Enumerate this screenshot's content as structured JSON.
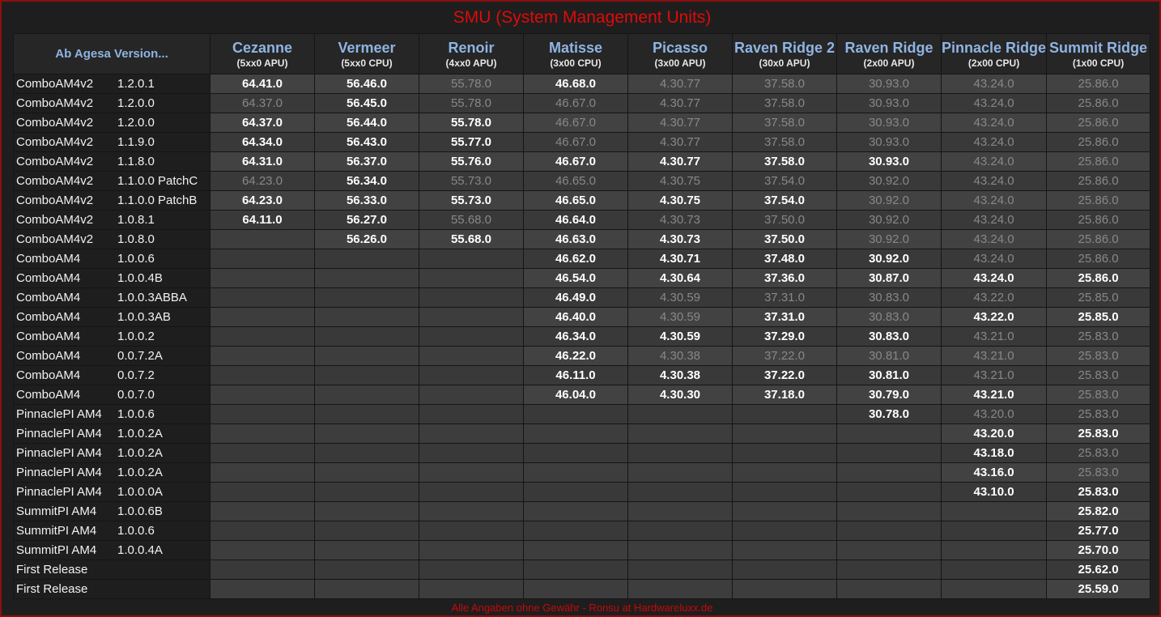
{
  "title": "SMU (System Management Units)",
  "footer": "Alle Angaben ohne Gewähr - Ronsu at Hardwareluxx.de",
  "corner_label": "Ab Agesa Version...",
  "columns": [
    {
      "name": "Cezanne",
      "sub": "(5xx0 APU)"
    },
    {
      "name": "Vermeer",
      "sub": "(5xx0 CPU)"
    },
    {
      "name": "Renoir",
      "sub": "(4xx0 APU)"
    },
    {
      "name": "Matisse",
      "sub": "(3x00 CPU)"
    },
    {
      "name": "Picasso",
      "sub": "(3x00 APU)"
    },
    {
      "name": "Raven Ridge 2",
      "sub": "(30x0 APU)"
    },
    {
      "name": "Raven Ridge",
      "sub": "(2x00 APU)"
    },
    {
      "name": "Pinnacle Ridge",
      "sub": "(2x00 CPU)"
    },
    {
      "name": "Summit Ridge",
      "sub": "(1x00 CPU)"
    }
  ],
  "colors": {
    "title_red": "#e00a0a",
    "header_blue": "#8fb4e3",
    "value_bright": "#ffffff",
    "value_dim": "#888888"
  },
  "rows": [
    {
      "board": "ComboAM4v2",
      "ver": "1.2.0.1",
      "cells": [
        [
          "64.41.0",
          "b"
        ],
        [
          "56.46.0",
          "b"
        ],
        [
          "55.78.0",
          "d"
        ],
        [
          "46.68.0",
          "b"
        ],
        [
          "4.30.77",
          "d"
        ],
        [
          "37.58.0",
          "d"
        ],
        [
          "30.93.0",
          "d"
        ],
        [
          "43.24.0",
          "d"
        ],
        [
          "25.86.0",
          "d"
        ]
      ]
    },
    {
      "board": "ComboAM4v2",
      "ver": "1.2.0.0",
      "cells": [
        [
          "64.37.0",
          "d"
        ],
        [
          "56.45.0",
          "b"
        ],
        [
          "55.78.0",
          "d"
        ],
        [
          "46.67.0",
          "d"
        ],
        [
          "4.30.77",
          "d"
        ],
        [
          "37.58.0",
          "d"
        ],
        [
          "30.93.0",
          "d"
        ],
        [
          "43.24.0",
          "d"
        ],
        [
          "25.86.0",
          "d"
        ]
      ]
    },
    {
      "board": "ComboAM4v2",
      "ver": "1.2.0.0",
      "cells": [
        [
          "64.37.0",
          "b"
        ],
        [
          "56.44.0",
          "b"
        ],
        [
          "55.78.0",
          "b"
        ],
        [
          "46.67.0",
          "d"
        ],
        [
          "4.30.77",
          "d"
        ],
        [
          "37.58.0",
          "d"
        ],
        [
          "30.93.0",
          "d"
        ],
        [
          "43.24.0",
          "d"
        ],
        [
          "25.86.0",
          "d"
        ]
      ]
    },
    {
      "board": "ComboAM4v2",
      "ver": "1.1.9.0",
      "cells": [
        [
          "64.34.0",
          "b"
        ],
        [
          "56.43.0",
          "b"
        ],
        [
          "55.77.0",
          "b"
        ],
        [
          "46.67.0",
          "d"
        ],
        [
          "4.30.77",
          "d"
        ],
        [
          "37.58.0",
          "d"
        ],
        [
          "30.93.0",
          "d"
        ],
        [
          "43.24.0",
          "d"
        ],
        [
          "25.86.0",
          "d"
        ]
      ]
    },
    {
      "board": "ComboAM4v2",
      "ver": "1.1.8.0",
      "cells": [
        [
          "64.31.0",
          "b"
        ],
        [
          "56.37.0",
          "b"
        ],
        [
          "55.76.0",
          "b"
        ],
        [
          "46.67.0",
          "b"
        ],
        [
          "4.30.77",
          "b"
        ],
        [
          "37.58.0",
          "b"
        ],
        [
          "30.93.0",
          "b"
        ],
        [
          "43.24.0",
          "d"
        ],
        [
          "25.86.0",
          "d"
        ]
      ]
    },
    {
      "board": "ComboAM4v2",
      "ver": "1.1.0.0 PatchC",
      "cells": [
        [
          "64.23.0",
          "d"
        ],
        [
          "56.34.0",
          "b"
        ],
        [
          "55.73.0",
          "d"
        ],
        [
          "46.65.0",
          "d"
        ],
        [
          "4.30.75",
          "d"
        ],
        [
          "37.54.0",
          "d"
        ],
        [
          "30.92.0",
          "d"
        ],
        [
          "43.24.0",
          "d"
        ],
        [
          "25.86.0",
          "d"
        ]
      ]
    },
    {
      "board": "ComboAM4v2",
      "ver": "1.1.0.0 PatchB",
      "cells": [
        [
          "64.23.0",
          "b"
        ],
        [
          "56.33.0",
          "b"
        ],
        [
          "55.73.0",
          "b"
        ],
        [
          "46.65.0",
          "b"
        ],
        [
          "4.30.75",
          "b"
        ],
        [
          "37.54.0",
          "b"
        ],
        [
          "30.92.0",
          "d"
        ],
        [
          "43.24.0",
          "d"
        ],
        [
          "25.86.0",
          "d"
        ]
      ]
    },
    {
      "board": "ComboAM4v2",
      "ver": "1.0.8.1",
      "cells": [
        [
          "64.11.0",
          "b"
        ],
        [
          "56.27.0",
          "b"
        ],
        [
          "55.68.0",
          "d"
        ],
        [
          "46.64.0",
          "b"
        ],
        [
          "4.30.73",
          "d"
        ],
        [
          "37.50.0",
          "d"
        ],
        [
          "30.92.0",
          "d"
        ],
        [
          "43.24.0",
          "d"
        ],
        [
          "25.86.0",
          "d"
        ]
      ]
    },
    {
      "board": "ComboAM4v2",
      "ver": "1.0.8.0",
      "cells": [
        [
          "",
          ""
        ],
        [
          "56.26.0",
          "b"
        ],
        [
          "55.68.0",
          "b"
        ],
        [
          "46.63.0",
          "b"
        ],
        [
          "4.30.73",
          "b"
        ],
        [
          "37.50.0",
          "b"
        ],
        [
          "30.92.0",
          "d"
        ],
        [
          "43.24.0",
          "d"
        ],
        [
          "25.86.0",
          "d"
        ]
      ]
    },
    {
      "board": "ComboAM4",
      "ver": "1.0.0.6",
      "cells": [
        [
          "",
          ""
        ],
        [
          "",
          ""
        ],
        [
          "",
          ""
        ],
        [
          "46.62.0",
          "b"
        ],
        [
          "4.30.71",
          "b"
        ],
        [
          "37.48.0",
          "b"
        ],
        [
          "30.92.0",
          "b"
        ],
        [
          "43.24.0",
          "d"
        ],
        [
          "25.86.0",
          "d"
        ]
      ]
    },
    {
      "board": "ComboAM4",
      "ver": "1.0.0.4B",
      "cells": [
        [
          "",
          ""
        ],
        [
          "",
          ""
        ],
        [
          "",
          ""
        ],
        [
          "46.54.0",
          "b"
        ],
        [
          "4.30.64",
          "b"
        ],
        [
          "37.36.0",
          "b"
        ],
        [
          "30.87.0",
          "b"
        ],
        [
          "43.24.0",
          "b"
        ],
        [
          "25.86.0",
          "b"
        ]
      ]
    },
    {
      "board": "ComboAM4",
      "ver": "1.0.0.3ABBA",
      "cells": [
        [
          "",
          ""
        ],
        [
          "",
          ""
        ],
        [
          "",
          ""
        ],
        [
          "46.49.0",
          "b"
        ],
        [
          "4.30.59",
          "d"
        ],
        [
          "37.31.0",
          "d"
        ],
        [
          "30.83.0",
          "d"
        ],
        [
          "43.22.0",
          "d"
        ],
        [
          "25.85.0",
          "d"
        ]
      ]
    },
    {
      "board": "ComboAM4",
      "ver": "1.0.0.3AB",
      "cells": [
        [
          "",
          ""
        ],
        [
          "",
          ""
        ],
        [
          "",
          ""
        ],
        [
          "46.40.0",
          "b"
        ],
        [
          "4.30.59",
          "d"
        ],
        [
          "37.31.0",
          "b"
        ],
        [
          "30.83.0",
          "d"
        ],
        [
          "43.22.0",
          "b"
        ],
        [
          "25.85.0",
          "b"
        ]
      ]
    },
    {
      "board": "ComboAM4",
      "ver": "1.0.0.2",
      "cells": [
        [
          "",
          ""
        ],
        [
          "",
          ""
        ],
        [
          "",
          ""
        ],
        [
          "46.34.0",
          "b"
        ],
        [
          "4.30.59",
          "b"
        ],
        [
          "37.29.0",
          "b"
        ],
        [
          "30.83.0",
          "b"
        ],
        [
          "43.21.0",
          "d"
        ],
        [
          "25.83.0",
          "d"
        ]
      ]
    },
    {
      "board": "ComboAM4",
      "ver": "0.0.7.2A",
      "cells": [
        [
          "",
          ""
        ],
        [
          "",
          ""
        ],
        [
          "",
          ""
        ],
        [
          "46.22.0",
          "b"
        ],
        [
          "4.30.38",
          "d"
        ],
        [
          "37.22.0",
          "d"
        ],
        [
          "30.81.0",
          "d"
        ],
        [
          "43.21.0",
          "d"
        ],
        [
          "25.83.0",
          "d"
        ]
      ]
    },
    {
      "board": "ComboAM4",
      "ver": "0.0.7.2",
      "cells": [
        [
          "",
          ""
        ],
        [
          "",
          ""
        ],
        [
          "",
          ""
        ],
        [
          "46.11.0",
          "b"
        ],
        [
          "4.30.38",
          "b"
        ],
        [
          "37.22.0",
          "b"
        ],
        [
          "30.81.0",
          "b"
        ],
        [
          "43.21.0",
          "d"
        ],
        [
          "25.83.0",
          "d"
        ]
      ]
    },
    {
      "board": "ComboAM4",
      "ver": "0.0.7.0",
      "cells": [
        [
          "",
          ""
        ],
        [
          "",
          ""
        ],
        [
          "",
          ""
        ],
        [
          "46.04.0",
          "b"
        ],
        [
          "4.30.30",
          "b"
        ],
        [
          "37.18.0",
          "b"
        ],
        [
          "30.79.0",
          "b"
        ],
        [
          "43.21.0",
          "b"
        ],
        [
          "25.83.0",
          "d"
        ]
      ]
    },
    {
      "board": "PinnaclePI AM4",
      "ver": "1.0.0.6",
      "cells": [
        [
          "",
          ""
        ],
        [
          "",
          ""
        ],
        [
          "",
          ""
        ],
        [
          "",
          ""
        ],
        [
          "",
          ""
        ],
        [
          "",
          ""
        ],
        [
          "30.78.0",
          "b"
        ],
        [
          "43.20.0",
          "d"
        ],
        [
          "25.83.0",
          "d"
        ]
      ]
    },
    {
      "board": "PinnaclePI AM4",
      "ver": "1.0.0.2A",
      "cells": [
        [
          "",
          ""
        ],
        [
          "",
          ""
        ],
        [
          "",
          ""
        ],
        [
          "",
          ""
        ],
        [
          "",
          ""
        ],
        [
          "",
          ""
        ],
        [
          "",
          ""
        ],
        [
          "43.20.0",
          "b"
        ],
        [
          "25.83.0",
          "b"
        ]
      ]
    },
    {
      "board": "PinnaclePI AM4",
      "ver": "1.0.0.2A",
      "cells": [
        [
          "",
          ""
        ],
        [
          "",
          ""
        ],
        [
          "",
          ""
        ],
        [
          "",
          ""
        ],
        [
          "",
          ""
        ],
        [
          "",
          ""
        ],
        [
          "",
          ""
        ],
        [
          "43.18.0",
          "b"
        ],
        [
          "25.83.0",
          "d"
        ]
      ]
    },
    {
      "board": "PinnaclePI AM4",
      "ver": "1.0.0.2A",
      "cells": [
        [
          "",
          ""
        ],
        [
          "",
          ""
        ],
        [
          "",
          ""
        ],
        [
          "",
          ""
        ],
        [
          "",
          ""
        ],
        [
          "",
          ""
        ],
        [
          "",
          ""
        ],
        [
          "43.16.0",
          "b"
        ],
        [
          "25.83.0",
          "d"
        ]
      ]
    },
    {
      "board": "PinnaclePI AM4",
      "ver": "1.0.0.0A",
      "cells": [
        [
          "",
          ""
        ],
        [
          "",
          ""
        ],
        [
          "",
          ""
        ],
        [
          "",
          ""
        ],
        [
          "",
          ""
        ],
        [
          "",
          ""
        ],
        [
          "",
          ""
        ],
        [
          "43.10.0",
          "b"
        ],
        [
          "25.83.0",
          "b"
        ]
      ]
    },
    {
      "board": "SummitPI AM4",
      "ver": "1.0.0.6B",
      "cells": [
        [
          "",
          ""
        ],
        [
          "",
          ""
        ],
        [
          "",
          ""
        ],
        [
          "",
          ""
        ],
        [
          "",
          ""
        ],
        [
          "",
          ""
        ],
        [
          "",
          ""
        ],
        [
          "",
          ""
        ],
        [
          "25.82.0",
          "b"
        ]
      ]
    },
    {
      "board": "SummitPI AM4",
      "ver": "1.0.0.6",
      "cells": [
        [
          "",
          ""
        ],
        [
          "",
          ""
        ],
        [
          "",
          ""
        ],
        [
          "",
          ""
        ],
        [
          "",
          ""
        ],
        [
          "",
          ""
        ],
        [
          "",
          ""
        ],
        [
          "",
          ""
        ],
        [
          "25.77.0",
          "b"
        ]
      ]
    },
    {
      "board": "SummitPI AM4",
      "ver": "1.0.0.4A",
      "cells": [
        [
          "",
          ""
        ],
        [
          "",
          ""
        ],
        [
          "",
          ""
        ],
        [
          "",
          ""
        ],
        [
          "",
          ""
        ],
        [
          "",
          ""
        ],
        [
          "",
          ""
        ],
        [
          "",
          ""
        ],
        [
          "25.70.0",
          "b"
        ]
      ]
    },
    {
      "board": "First Release",
      "ver": "",
      "cells": [
        [
          "",
          ""
        ],
        [
          "",
          ""
        ],
        [
          "",
          ""
        ],
        [
          "",
          ""
        ],
        [
          "",
          ""
        ],
        [
          "",
          ""
        ],
        [
          "",
          ""
        ],
        [
          "",
          ""
        ],
        [
          "25.62.0",
          "b"
        ]
      ]
    },
    {
      "board": "First Release",
      "ver": "",
      "cells": [
        [
          "",
          ""
        ],
        [
          "",
          ""
        ],
        [
          "",
          ""
        ],
        [
          "",
          ""
        ],
        [
          "",
          ""
        ],
        [
          "",
          ""
        ],
        [
          "",
          ""
        ],
        [
          "",
          ""
        ],
        [
          "25.59.0",
          "b"
        ]
      ]
    }
  ]
}
